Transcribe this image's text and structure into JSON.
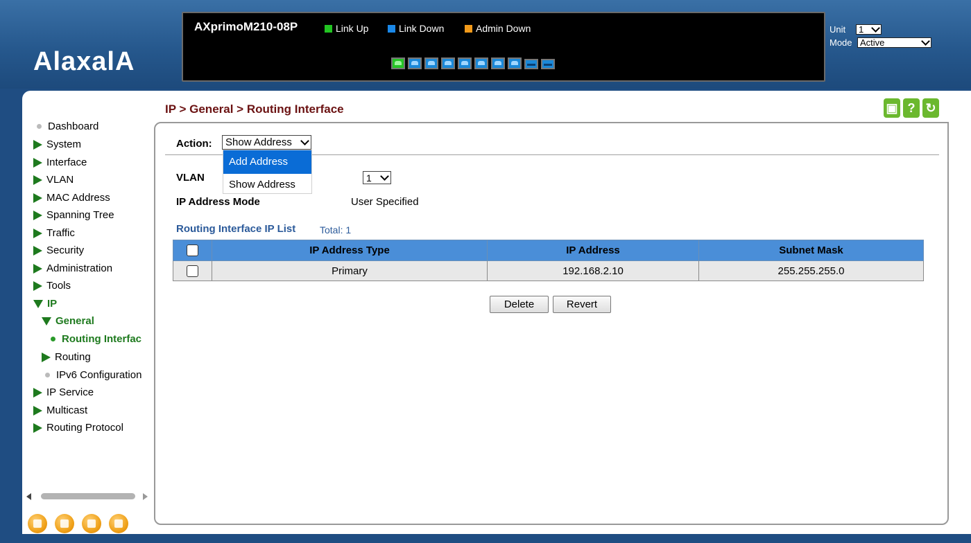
{
  "header": {
    "logo": "AlaxalA",
    "model": "AXprimoM210-08P",
    "legend": [
      {
        "label": "Link Up",
        "color": "#22c422"
      },
      {
        "label": "Link Down",
        "color": "#1a88e8"
      },
      {
        "label": "Admin Down",
        "color": "#f29a1a"
      }
    ],
    "unit_label": "Unit",
    "unit_value": "1",
    "mode_label": "Mode",
    "mode_value": "Active"
  },
  "ports": [
    "up",
    "down",
    "down",
    "down",
    "down",
    "down",
    "down",
    "down",
    "sfp",
    "sfp"
  ],
  "sidebar": {
    "items": [
      {
        "label": "Dashboard"
      },
      {
        "label": "System"
      },
      {
        "label": "Interface"
      },
      {
        "label": "VLAN"
      },
      {
        "label": "MAC Address"
      },
      {
        "label": "Spanning Tree"
      },
      {
        "label": "Traffic"
      },
      {
        "label": "Security"
      },
      {
        "label": "Administration"
      },
      {
        "label": "Tools"
      },
      {
        "label": "IP"
      },
      {
        "label": "General"
      },
      {
        "label": "Routing Interfac"
      },
      {
        "label": "Routing"
      },
      {
        "label": "IPv6 Configuration"
      },
      {
        "label": "IP Service"
      },
      {
        "label": "Multicast"
      },
      {
        "label": "Routing Protocol"
      }
    ]
  },
  "page": {
    "breadcrumb": "IP > General > Routing Interface",
    "action_label": "Action:",
    "action_value": "Show Address",
    "dropdown_options": [
      "Add Address",
      "Show Address"
    ],
    "vlan_label": "VLAN",
    "vlan_value": "1",
    "mode_label": "IP Address Mode",
    "mode_value": "User Specified",
    "list_title": "Routing Interface IP List",
    "list_total": "Total: 1",
    "table": {
      "headers": [
        "IP Address Type",
        "IP Address",
        "Subnet Mask"
      ],
      "rows": [
        [
          "Primary",
          "192.168.2.10",
          "255.255.255.0"
        ]
      ]
    },
    "delete_label": "Delete",
    "revert_label": "Revert"
  },
  "colors": {
    "breadcrumb": "#6b1212",
    "nav_active": "#1e7a1e",
    "table_header": "#4a8ed8",
    "dropdown_highlight": "#0a6cd6"
  }
}
